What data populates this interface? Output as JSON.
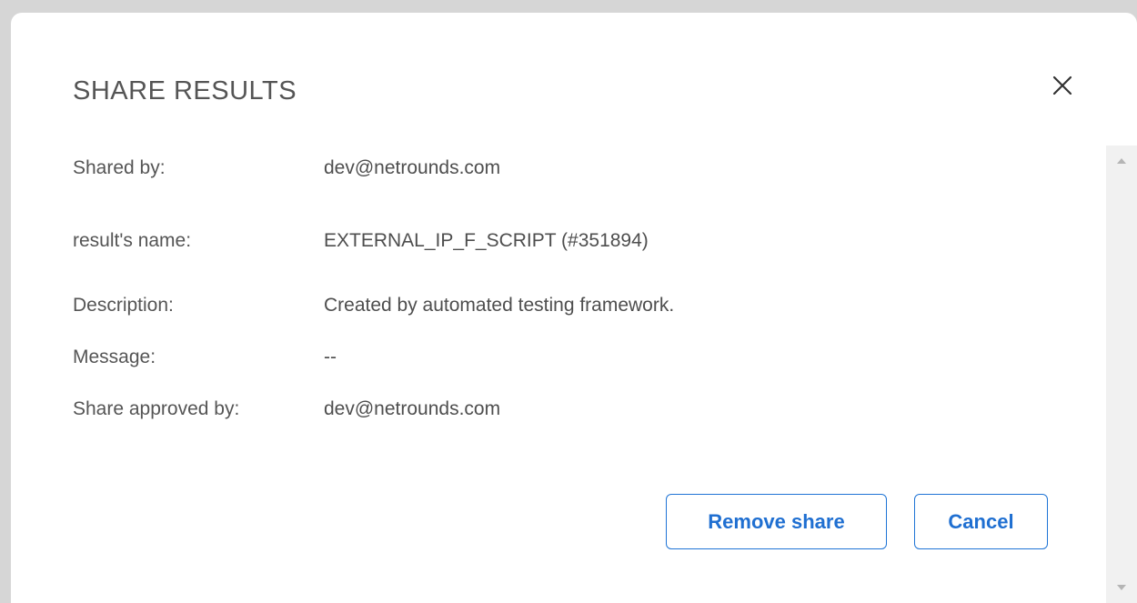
{
  "dialog": {
    "title": "SHARE RESULTS",
    "close_icon": "close-icon"
  },
  "details": [
    {
      "label": "Shared by:",
      "value": "dev@netrounds.com"
    },
    {
      "label": "result's name:",
      "value": "EXTERNAL_IP_F_SCRIPT (#351894)"
    },
    {
      "label": "Description:",
      "value": "Created by automated testing framework."
    },
    {
      "label": "Message:",
      "value": "--"
    },
    {
      "label": "Share approved by:",
      "value": "dev@netrounds.com"
    }
  ],
  "buttons": {
    "remove_share": "Remove share",
    "cancel": "Cancel"
  },
  "colors": {
    "accent": "#1f74d6",
    "text": "#555555",
    "backdrop": "#d6d6d6"
  }
}
